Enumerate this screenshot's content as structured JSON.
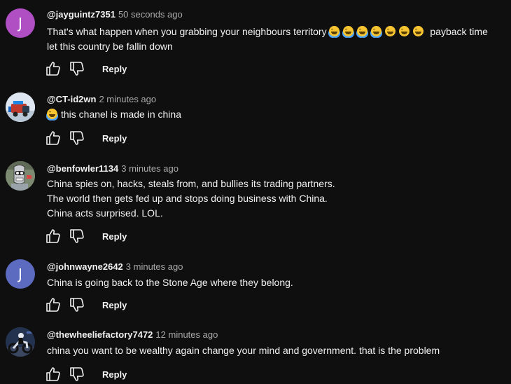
{
  "comments": [
    {
      "author": "@jayguintz7351",
      "time": "50 seconds ago",
      "avatar_letter": "J",
      "avatar_color": "#b04fc4",
      "line1": "That's what happen when you grabbing your neighbours territory",
      "line1_tail": "payback time",
      "line2": "let this country be fallin down",
      "reply_label": "Reply"
    },
    {
      "author": "@CT-id2wn",
      "time": "2 minutes ago",
      "avatar_icon": "truck-cartoon-avatar",
      "text": "this chanel is made in china",
      "reply_label": "Reply"
    },
    {
      "author": "@benfowler1134",
      "time": "3 minutes ago",
      "avatar_icon": "robot-cartoon-avatar",
      "lines": [
        "China spies on, hacks, steals from, and bullies its trading partners.",
        "The world then gets fed up and stops doing business with China.",
        "China acts surprised. LOL."
      ],
      "reply_label": "Reply"
    },
    {
      "author": "@johnwayne2642",
      "time": "3 minutes ago",
      "avatar_letter": "J",
      "avatar_color": "#5c6bc0",
      "text": "China is going back to the Stone Age where they belong.",
      "reply_label": "Reply"
    },
    {
      "author": "@thewheeliefactory7472",
      "time": "12 minutes ago",
      "avatar_icon": "motorcycle-photo-avatar",
      "text": "china you want to be wealthy again change your mind and government. that is the problem",
      "reply_label": "Reply"
    }
  ]
}
